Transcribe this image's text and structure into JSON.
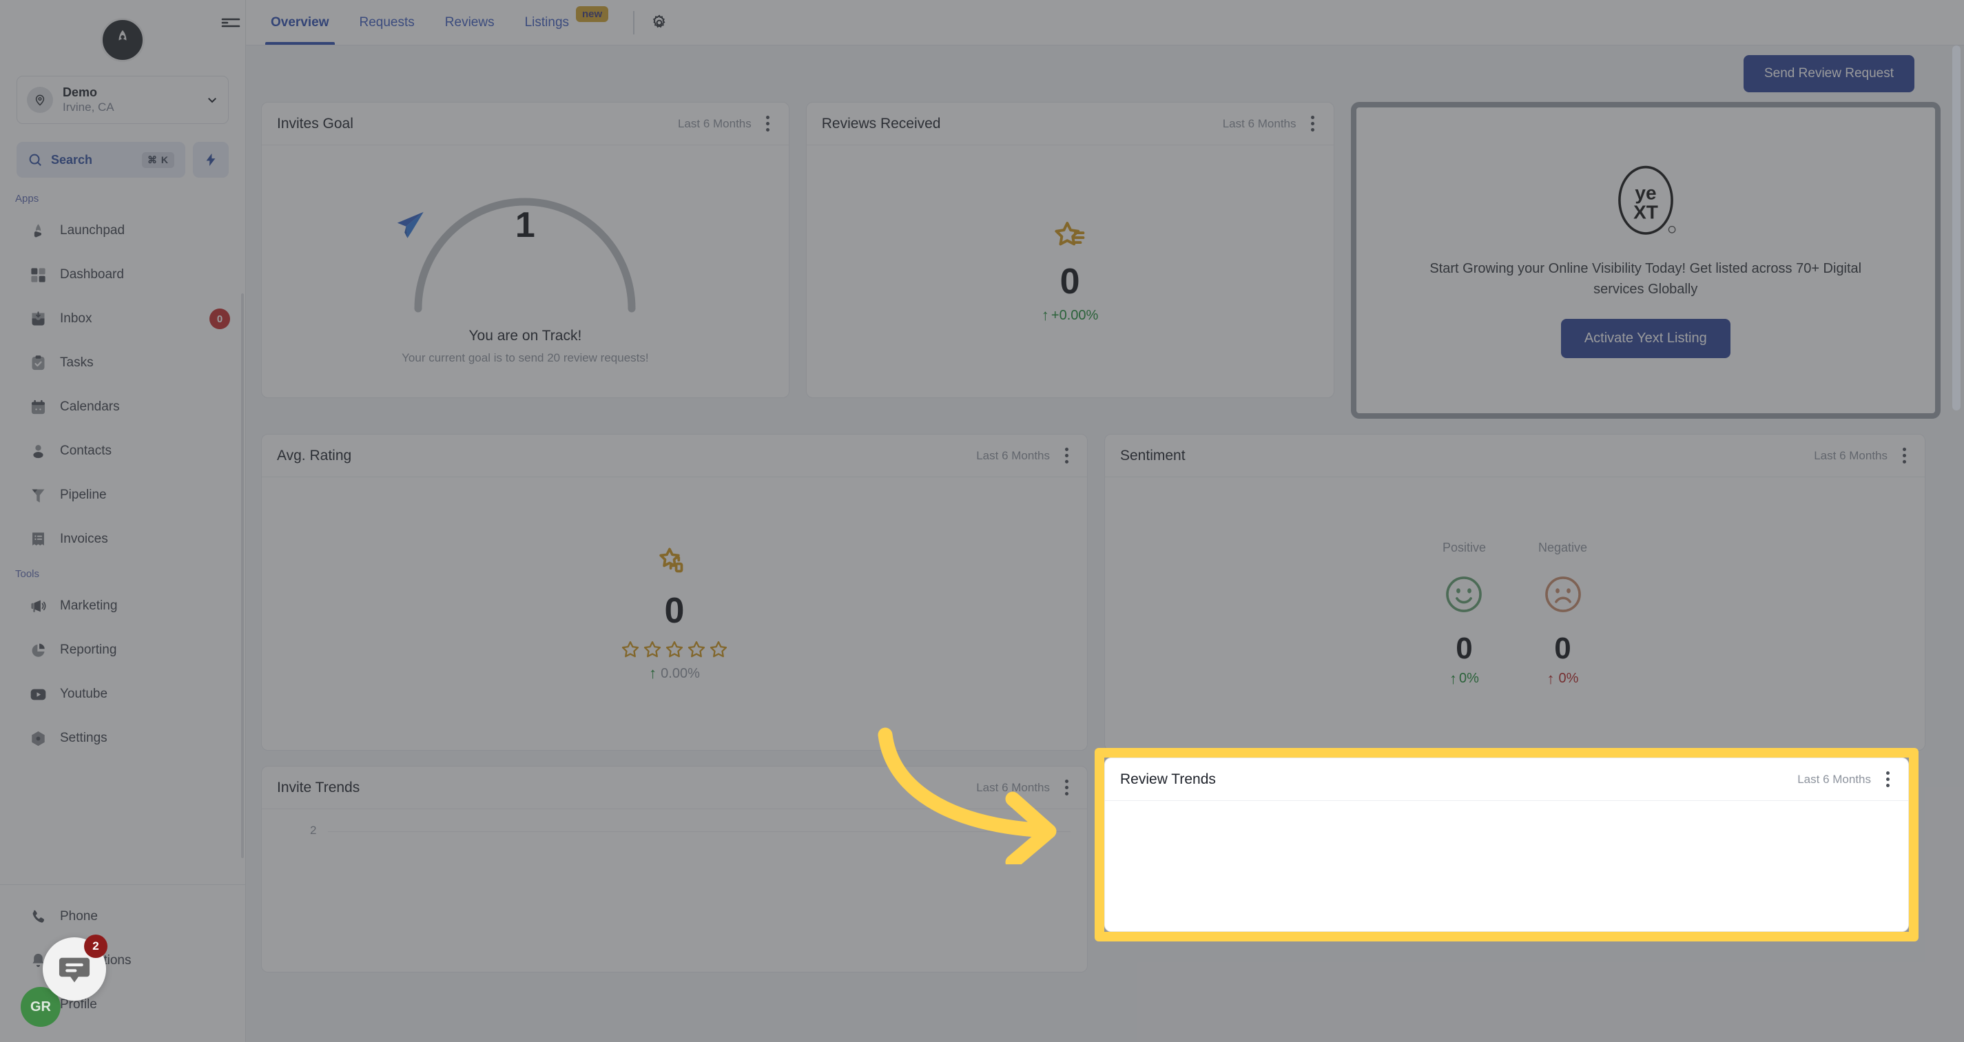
{
  "sidebar": {
    "logo_icon": "rocket-logo-icon",
    "location": {
      "name": "Demo",
      "sub": "Irvine, CA",
      "avatar_icon": "map-pin-icon",
      "chevron_icon": "chevron-down-icon"
    },
    "search": {
      "label": "Search",
      "shortcut": "⌘ K",
      "icon": "search-icon"
    },
    "quick_action_icon": "lightning-bolt-icon",
    "groups": [
      {
        "label": "Apps",
        "items": [
          {
            "label": "Launchpad",
            "icon": "rocket-icon"
          },
          {
            "label": "Dashboard",
            "icon": "grid-squares-icon"
          },
          {
            "label": "Inbox",
            "icon": "inbox-icon",
            "badge": "0"
          },
          {
            "label": "Tasks",
            "icon": "clipboard-check-icon"
          },
          {
            "label": "Calendars",
            "icon": "calendar-icon"
          },
          {
            "label": "Contacts",
            "icon": "person-icon"
          },
          {
            "label": "Pipeline",
            "icon": "funnel-icon"
          },
          {
            "label": "Invoices",
            "icon": "receipt-icon"
          }
        ]
      },
      {
        "label": "Tools",
        "items": [
          {
            "label": "Marketing",
            "icon": "megaphone-icon"
          },
          {
            "label": "Reporting",
            "icon": "pie-chart-icon"
          },
          {
            "label": "Youtube",
            "icon": "youtube-icon"
          },
          {
            "label": "Settings",
            "icon": "hexagon-gear-icon"
          }
        ]
      }
    ],
    "bottom_items": [
      {
        "label": "Phone",
        "icon": "phone-icon"
      },
      {
        "label": "Notifications",
        "icon": "bell-icon"
      },
      {
        "label": "Profile",
        "icon": "user-circle-icon"
      }
    ]
  },
  "topbar": {
    "menu_icon": "hamburger-menu-icon",
    "tabs": [
      {
        "label": "Overview",
        "active": true
      },
      {
        "label": "Requests",
        "active": false
      },
      {
        "label": "Reviews",
        "active": false
      },
      {
        "label": "Listings",
        "active": false,
        "badge": "new"
      }
    ],
    "settings_icon": "gear-icon"
  },
  "actions": {
    "send_review_request": "Send Review Request"
  },
  "cards": {
    "invites_goal": {
      "title": "Invites Goal",
      "period": "Last 6 Months",
      "menu_icon": "kebab-menu-icon",
      "value": "1",
      "status": "You are on Track!",
      "subtitle": "Your current goal is to send 20 review requests!",
      "icon": "paper-plane-icon",
      "gauge_progress_pct": 5
    },
    "reviews_received": {
      "title": "Reviews Received",
      "period": "Last 6 Months",
      "menu_icon": "kebab-menu-icon",
      "value": "0",
      "delta": "+0.00%",
      "delta_direction": "up",
      "icon": "star-review-icon"
    },
    "yext": {
      "logo_text_top": "ye",
      "logo_text_bottom": "XT",
      "message": "Start Growing your Online Visibility Today! Get listed across 70+ Digital services Globally",
      "button": "Activate Yext Listing"
    },
    "avg_rating": {
      "title": "Avg. Rating",
      "period": "Last 6 Months",
      "menu_icon": "kebab-menu-icon",
      "value": "0",
      "stars_total": 5,
      "stars_filled": 0,
      "delta": "0.00%",
      "delta_direction": "up",
      "icon": "star-rating-icon"
    },
    "sentiment": {
      "title": "Sentiment",
      "period": "Last 6 Months",
      "menu_icon": "kebab-menu-icon",
      "positive": {
        "label": "Positive",
        "value": "0",
        "delta": "0%",
        "icon": "smiley-face-icon"
      },
      "negative": {
        "label": "Negative",
        "value": "0",
        "delta": "0%",
        "icon": "frowny-face-icon"
      }
    },
    "invite_trends": {
      "title": "Invite Trends",
      "period": "Last 6 Months",
      "menu_icon": "kebab-menu-icon",
      "y_tick": "2"
    },
    "review_trends": {
      "title": "Review Trends",
      "period": "Last 6 Months",
      "menu_icon": "kebab-menu-icon"
    }
  },
  "chat_widget": {
    "badge": "2",
    "icon": "chat-bubble-icon",
    "avatar_initials": "GR"
  },
  "colors": {
    "accent_blue": "#2b4195",
    "link_blue": "#3b5bbf",
    "highlight_yellow": "#FFD24D",
    "star_gold": "#cf9416",
    "positive_green": "#1a8a32",
    "negative_red": "#b32020",
    "badge_red": "#c22929",
    "new_badge": "#cfa22c"
  },
  "chart_data": [
    {
      "type": "line",
      "title": "Invite Trends",
      "subtitle": "Last 6 Months",
      "categories": [],
      "values": [],
      "xlabel": "",
      "ylabel": "",
      "yticks": [
        "2"
      ],
      "ylim": [
        0,
        2
      ],
      "grid": true,
      "legend": "none",
      "note": "Chart plot area is empty (no data series rendered)"
    },
    {
      "type": "line",
      "title": "Review Trends",
      "subtitle": "Last 6 Months",
      "categories": [],
      "values": [],
      "xlabel": "",
      "ylabel": "",
      "yticks": [],
      "grid": false,
      "legend": "none",
      "note": "Chart plot area is empty (no data series rendered)"
    }
  ]
}
